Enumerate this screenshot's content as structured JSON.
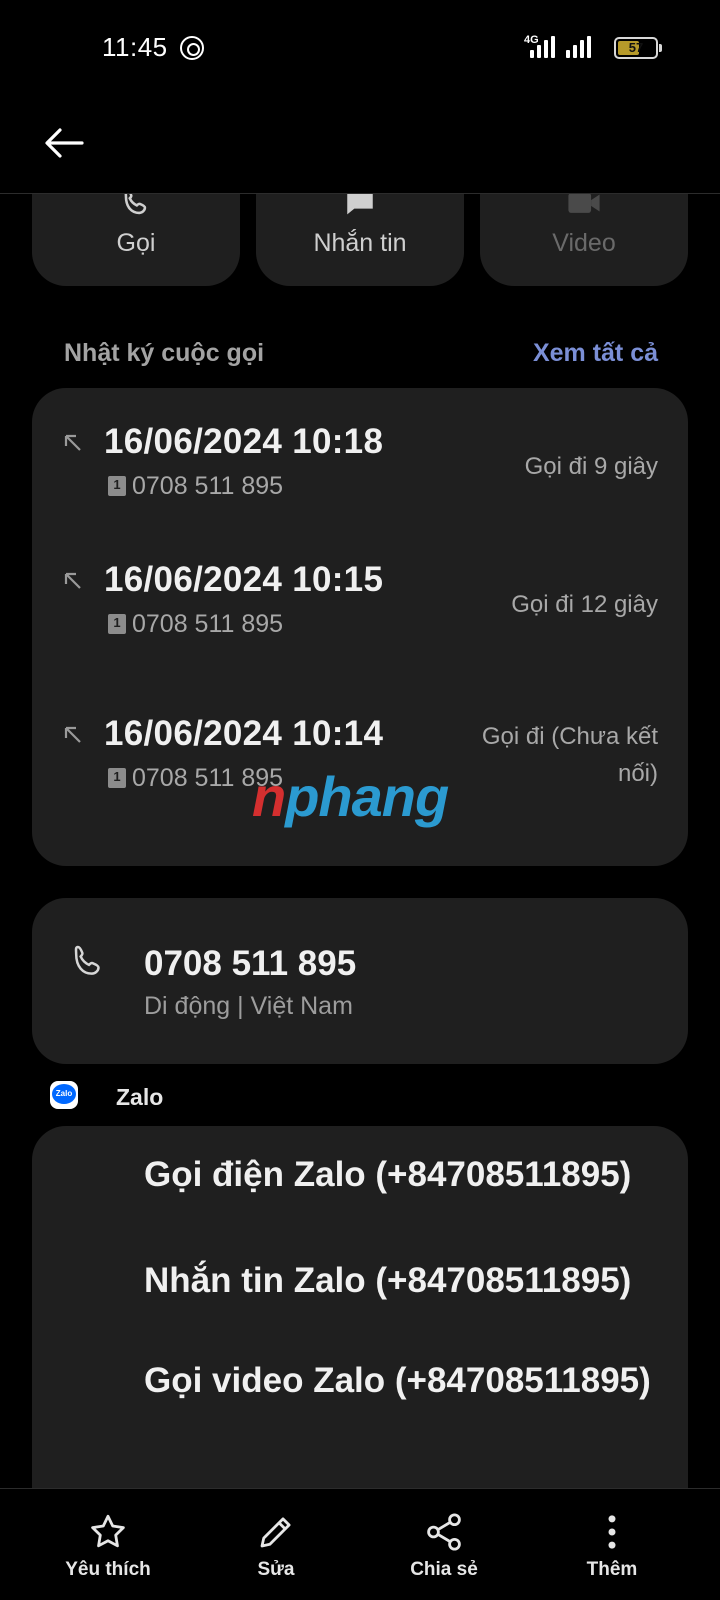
{
  "status_bar": {
    "time": "11:45",
    "network": "4G",
    "battery": "57",
    "battery_level": 0.57
  },
  "actions": [
    {
      "label": "Gọi",
      "icon": "phone-icon",
      "enabled": true
    },
    {
      "label": "Nhắn tin",
      "icon": "message-icon",
      "enabled": true
    },
    {
      "label": "Video",
      "icon": "video-icon",
      "enabled": false
    }
  ],
  "call_log": {
    "title": "Nhật ký cuộc gọi",
    "see_all": "Xem tất cả",
    "entries": [
      {
        "datetime": "16/06/2024 10:18",
        "sim": "1",
        "number": "0708 511 895",
        "status": "Gọi đi  9 giây"
      },
      {
        "datetime": "16/06/2024 10:15",
        "sim": "1",
        "number": "0708 511 895",
        "status": "Gọi đi  12 giây"
      },
      {
        "datetime": "16/06/2024 10:14",
        "sim": "1",
        "number": "0708 511 895",
        "status": "Gọi đi (Chưa kết nối)"
      }
    ]
  },
  "watermark": {
    "first": "n",
    "rest": "phang"
  },
  "contact": {
    "number": "0708 511 895",
    "meta": "Di động  |  Việt Nam"
  },
  "zalo": {
    "app_name": "Zalo",
    "logo_text": "Zalo",
    "actions": [
      "Gọi điện Zalo (+84708511895)",
      "Nhắn tin Zalo (+84708511895)",
      "Gọi video Zalo (+84708511895)"
    ]
  },
  "bottom_bar": [
    {
      "label": "Yêu thích",
      "icon": "star-icon"
    },
    {
      "label": "Sửa",
      "icon": "pencil-icon"
    },
    {
      "label": "Chia sẻ",
      "icon": "share-icon"
    },
    {
      "label": "Thêm",
      "icon": "more-icon"
    }
  ]
}
